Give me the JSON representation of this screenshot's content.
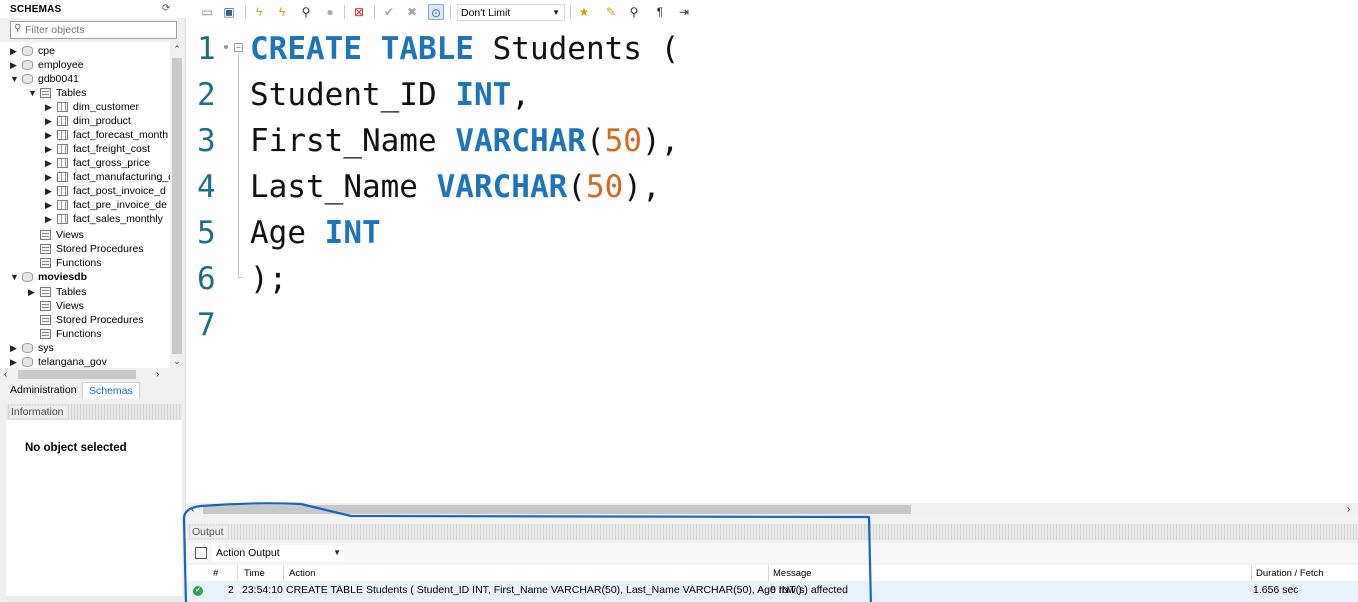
{
  "sidebar": {
    "title": "SCHEMAS",
    "filter_placeholder": "Filter objects",
    "tree": [
      {
        "label": "cpe",
        "expanded": false,
        "bold": false
      },
      {
        "label": "employee",
        "expanded": false,
        "bold": false
      },
      {
        "label": "gdb0041",
        "expanded": true,
        "bold": false,
        "tables_label": "Tables",
        "tables": [
          "dim_customer",
          "dim_product",
          "fact_forecast_month",
          "fact_freight_cost",
          "fact_gross_price",
          "fact_manufacturing_c",
          "fact_post_invoice_d",
          "fact_pre_invoice_de",
          "fact_sales_monthly"
        ],
        "views_label": "Views",
        "procedures_label": "Stored Procedures",
        "functions_label": "Functions"
      },
      {
        "label": "moviesdb",
        "expanded": true,
        "bold": true,
        "tables_label": "Tables",
        "views_label": "Views",
        "procedures_label": "Stored Procedures",
        "functions_label": "Functions"
      },
      {
        "label": "sys",
        "expanded": false,
        "bold": false
      },
      {
        "label": "telangana_gov",
        "expanded": false,
        "bold": false
      }
    ],
    "tabs": [
      "Administration",
      "Schemas"
    ],
    "active_tab": "Schemas",
    "info_title": "Information",
    "info_text": "No object selected"
  },
  "toolbar": {
    "limit_value": "Don't Limit",
    "icons": [
      "open-folder-icon",
      "save-icon",
      "execute-icon",
      "execute-current-icon",
      "explain-icon",
      "stop-icon",
      "toggle-error-icon",
      "commit-icon",
      "rollback-icon",
      "autocommit-icon",
      "limit-select",
      "bookmark-icon",
      "beautify-icon",
      "find-icon",
      "invisible-chars-icon",
      "wrap-icon"
    ]
  },
  "editor": {
    "lines": [
      {
        "n": "1",
        "tokens": [
          {
            "t": "CREATE",
            "c": "kw"
          },
          {
            "t": " "
          },
          {
            "t": "TABLE",
            "c": "kw"
          },
          {
            "t": " Students ("
          }
        ]
      },
      {
        "n": "2",
        "tokens": [
          {
            "t": "Student_ID "
          },
          {
            "t": "INT",
            "c": "kw"
          },
          {
            "t": ","
          }
        ]
      },
      {
        "n": "3",
        "tokens": [
          {
            "t": "First_Name "
          },
          {
            "t": "VARCHAR",
            "c": "kw"
          },
          {
            "t": "("
          },
          {
            "t": "50",
            "c": "num"
          },
          {
            "t": "),"
          }
        ]
      },
      {
        "n": "4",
        "tokens": [
          {
            "t": "Last_Name "
          },
          {
            "t": "VARCHAR",
            "c": "kw"
          },
          {
            "t": "("
          },
          {
            "t": "50",
            "c": "num"
          },
          {
            "t": "),"
          }
        ]
      },
      {
        "n": "5",
        "tokens": [
          {
            "t": "Age "
          },
          {
            "t": "INT",
            "c": "kw"
          }
        ]
      },
      {
        "n": "6",
        "tokens": [
          {
            "t": ");"
          }
        ]
      },
      {
        "n": "7",
        "tokens": []
      }
    ]
  },
  "output": {
    "title": "Output",
    "mode": "Action Output",
    "columns": [
      "#",
      "Time",
      "Action",
      "Message",
      "Duration / Fetch"
    ],
    "rows": [
      {
        "num": "2",
        "time": "23:54:10",
        "action": "CREATE TABLE Students ( Student_ID INT, First_Name VARCHAR(50), Last_Name VARCHAR(50), Age INT )",
        "message": "0 row(s) affected",
        "duration": "1.656 sec",
        "status": "success"
      }
    ]
  },
  "colors": {
    "keyword": "#1d74b8",
    "number": "#d2691e",
    "line_number": "#1d6f86",
    "accent_tab": "#1a6fb8",
    "annotation": "#1565c0"
  }
}
